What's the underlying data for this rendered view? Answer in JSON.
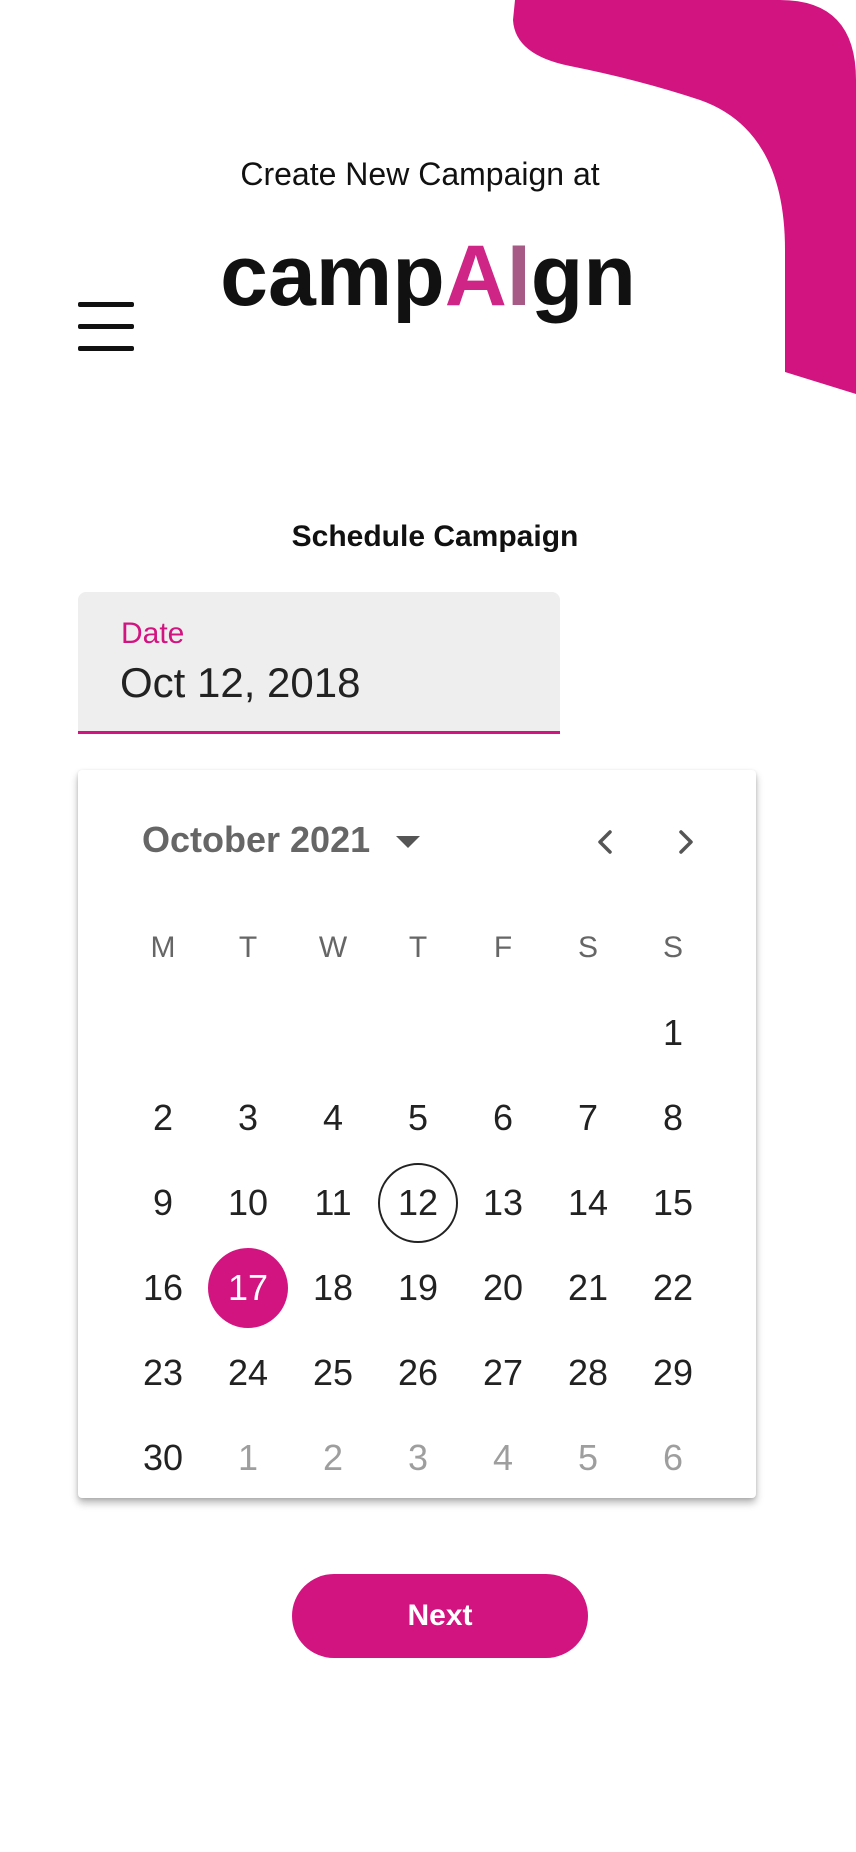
{
  "colors": {
    "accent": "#d21481",
    "logo_a": "#cf2586",
    "logo_i": "#a85a86",
    "text": "#111111",
    "muted_text": "#666666",
    "field_bg": "#eeeeee"
  },
  "header": {
    "subtitle": "Create New Campaign at",
    "logo": {
      "prefix": "camp",
      "highlight_a": "A",
      "highlight_i": "I",
      "suffix": "gn"
    },
    "menu_icon": "hamburger-menu-icon"
  },
  "schedule": {
    "title": "Schedule Campaign",
    "date_field": {
      "label": "Date",
      "value": "Oct 12, 2018"
    }
  },
  "calendar": {
    "month_label": "October 2021",
    "icons": {
      "dropdown": "caret-down-icon",
      "prev": "chevron-left-icon",
      "next": "chevron-right-icon"
    },
    "weekdays": [
      "M",
      "T",
      "W",
      "T",
      "F",
      "S",
      "S"
    ],
    "weeks": [
      [
        null,
        null,
        null,
        null,
        null,
        null,
        {
          "day": "1",
          "state": "current"
        }
      ],
      [
        {
          "day": "2",
          "state": "current"
        },
        {
          "day": "3",
          "state": "current"
        },
        {
          "day": "4",
          "state": "current"
        },
        {
          "day": "5",
          "state": "current"
        },
        {
          "day": "6",
          "state": "current"
        },
        {
          "day": "7",
          "state": "current"
        },
        {
          "day": "8",
          "state": "current"
        }
      ],
      [
        {
          "day": "9",
          "state": "current"
        },
        {
          "day": "10",
          "state": "current"
        },
        {
          "day": "11",
          "state": "current"
        },
        {
          "day": "12",
          "state": "today"
        },
        {
          "day": "13",
          "state": "current"
        },
        {
          "day": "14",
          "state": "current"
        },
        {
          "day": "15",
          "state": "current"
        }
      ],
      [
        {
          "day": "16",
          "state": "current"
        },
        {
          "day": "17",
          "state": "selected"
        },
        {
          "day": "18",
          "state": "current"
        },
        {
          "day": "19",
          "state": "current"
        },
        {
          "day": "20",
          "state": "current"
        },
        {
          "day": "21",
          "state": "current"
        },
        {
          "day": "22",
          "state": "current"
        }
      ],
      [
        {
          "day": "23",
          "state": "current"
        },
        {
          "day": "24",
          "state": "current"
        },
        {
          "day": "25",
          "state": "current"
        },
        {
          "day": "26",
          "state": "current"
        },
        {
          "day": "27",
          "state": "current"
        },
        {
          "day": "28",
          "state": "current"
        },
        {
          "day": "29",
          "state": "current"
        }
      ],
      [
        {
          "day": "30",
          "state": "current"
        },
        {
          "day": "1",
          "state": "outside"
        },
        {
          "day": "2",
          "state": "outside"
        },
        {
          "day": "3",
          "state": "outside"
        },
        {
          "day": "4",
          "state": "outside"
        },
        {
          "day": "5",
          "state": "outside"
        },
        {
          "day": "6",
          "state": "outside"
        }
      ]
    ]
  },
  "actions": {
    "next_label": "Next"
  }
}
